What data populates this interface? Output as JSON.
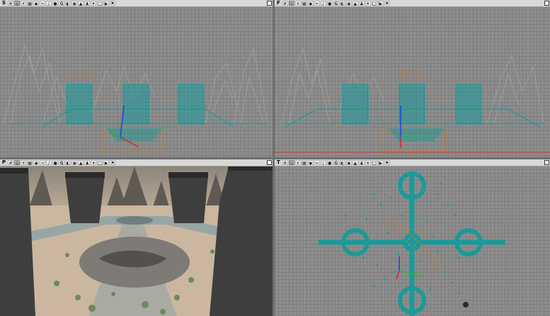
{
  "viewports": [
    {
      "id": "front",
      "mode_letter": "S"
    },
    {
      "id": "right",
      "mode_letter": "F"
    },
    {
      "id": "perspective",
      "mode_letter": "P"
    },
    {
      "id": "top",
      "mode_letter": "T"
    }
  ],
  "toolbar_glyphs": {
    "geometry": "G",
    "play": "▶"
  },
  "colors": {
    "wireframe_teal": "#1a9a9a",
    "wireframe_gray": "#a9a9a9",
    "active_border": "#e8e000",
    "axis_x": "#e02020",
    "axis_y": "#20c020",
    "axis_z": "#2040e0"
  },
  "icons": [
    "grid-icon",
    "camera-icon",
    "lighting-icon",
    "texture-icon",
    "eye-icon",
    "sound-icon",
    "build-icon",
    "geometry-icon",
    "play-icon",
    "maximize-icon"
  ]
}
